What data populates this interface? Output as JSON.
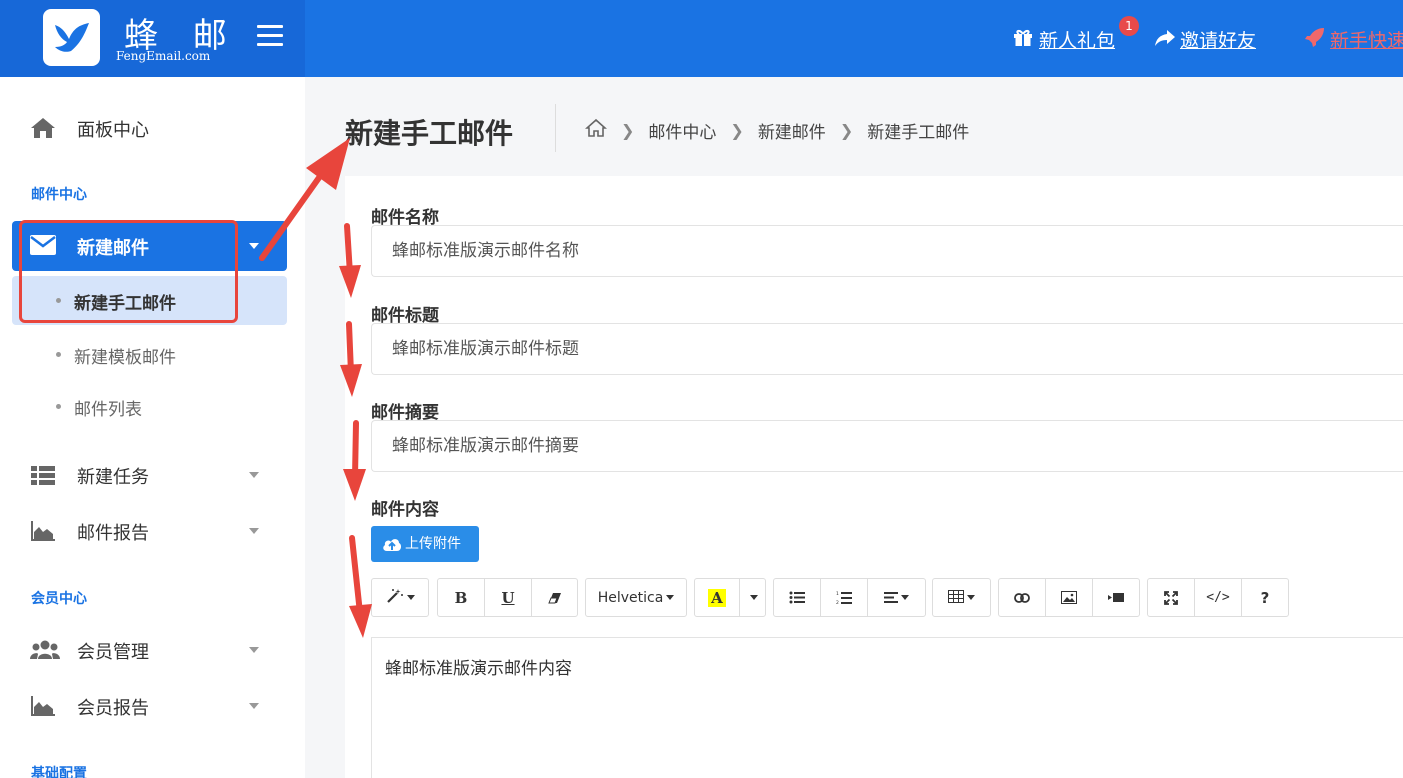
{
  "logo": {
    "name_cn": "蜂 邮",
    "name_en": "FengEmail.com"
  },
  "topbar": {
    "gift_label": "新人礼包",
    "gift_badge": "1",
    "invite_label": "邀请好友",
    "quickstart_label": "新手快速"
  },
  "sidebar": {
    "dashboard": "面板中心",
    "section_mail": "邮件中心",
    "new_mail": "新建邮件",
    "sub_manual": "新建手工邮件",
    "sub_template": "新建模板邮件",
    "sub_list": "邮件列表",
    "new_task": "新建任务",
    "mail_report": "邮件报告",
    "section_member": "会员中心",
    "member_manage": "会员管理",
    "member_report": "会员报告",
    "section_base": "基础配置"
  },
  "header": {
    "title": "新建手工邮件",
    "breadcrumb": [
      "邮件中心",
      "新建邮件",
      "新建手工邮件"
    ]
  },
  "form": {
    "name_label": "邮件名称",
    "name_value": "蜂邮标准版演示邮件名称",
    "subject_label": "邮件标题",
    "subject_value": "蜂邮标准版演示邮件标题",
    "summary_label": "邮件摘要",
    "summary_value": "蜂邮标准版演示邮件摘要",
    "content_label": "邮件内容",
    "upload_label": "上传附件",
    "font_name": "Helvetica",
    "content_value": "蜂邮标准版演示邮件内容"
  },
  "colors": {
    "primary": "#1a73e3",
    "accent_red": "#e8453c",
    "upload_blue": "#2a8de8"
  }
}
